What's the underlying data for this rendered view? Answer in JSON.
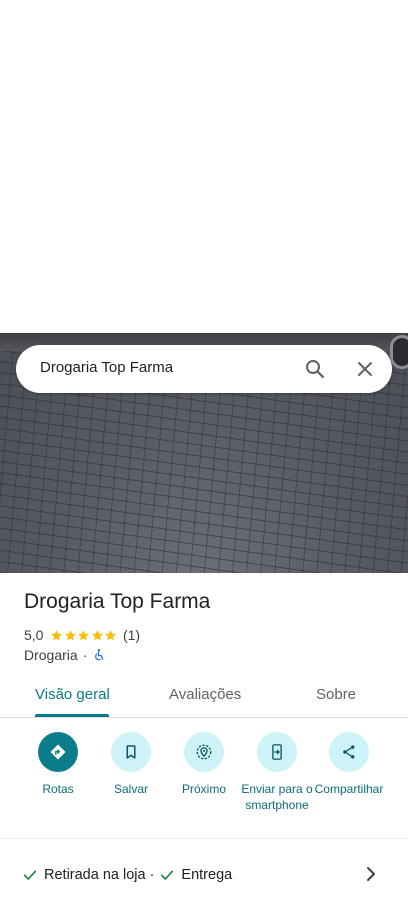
{
  "search": {
    "query": "Drogaria Top Farma"
  },
  "place": {
    "title": "Drogaria Top Farma",
    "rating": "5,0",
    "stars": 5,
    "review_count": "(1)",
    "category": "Drogaria",
    "separator": "·"
  },
  "tabs": [
    {
      "label": "Visão geral",
      "active": true
    },
    {
      "label": "Avaliações",
      "active": false
    },
    {
      "label": "Sobre",
      "active": false
    }
  ],
  "actions": [
    {
      "label": "Rotas",
      "icon": "directions-icon"
    },
    {
      "label": "Salvar",
      "icon": "bookmark-icon"
    },
    {
      "label": "Próximo",
      "icon": "nearby-icon"
    },
    {
      "label": "Enviar para o smartphone",
      "icon": "send-to-phone-icon"
    },
    {
      "label": "Compartilhar",
      "icon": "share-icon"
    }
  ],
  "services": {
    "pickup": "Retirada na loja",
    "separator": "·",
    "delivery": "Entrega"
  },
  "colors": {
    "accent": "#087a8a",
    "action_bg": "#cdf3f8",
    "primary_action_bg": "#0b7c8c",
    "star": "#fbbc04",
    "check": "#188038"
  }
}
